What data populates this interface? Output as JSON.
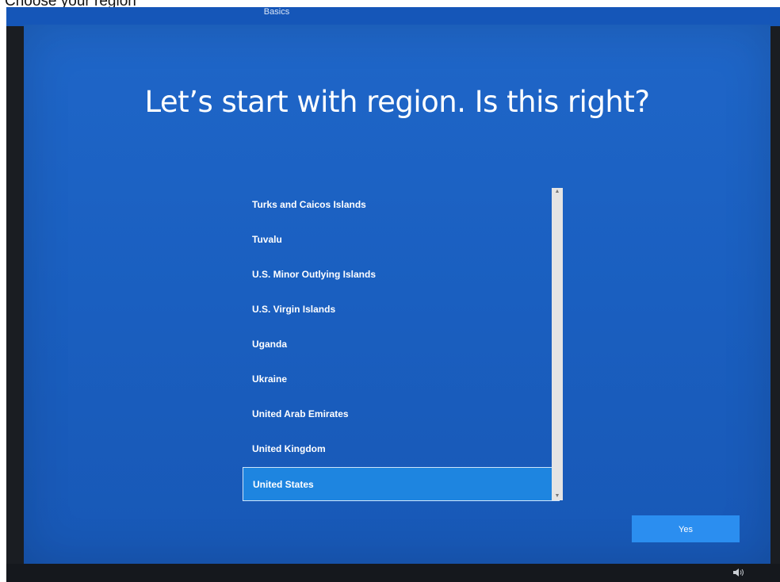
{
  "caption": "Choose your region",
  "header": {
    "tab_label": "Basics"
  },
  "main": {
    "title": "Let’s start with region. Is this right?",
    "regions": [
      {
        "label": "Turks and Caicos Islands",
        "selected": false
      },
      {
        "label": "Tuvalu",
        "selected": false
      },
      {
        "label": "U.S. Minor Outlying Islands",
        "selected": false
      },
      {
        "label": "U.S. Virgin Islands",
        "selected": false
      },
      {
        "label": "Uganda",
        "selected": false
      },
      {
        "label": "Ukraine",
        "selected": false
      },
      {
        "label": "United Arab Emirates",
        "selected": false
      },
      {
        "label": "United Kingdom",
        "selected": false
      },
      {
        "label": "United States",
        "selected": true
      }
    ],
    "yes_label": "Yes"
  },
  "taskbar": {
    "volume_icon": "volume-icon"
  },
  "colors": {
    "background": "#1a5fc0",
    "selected_item": "#1e85e0",
    "button": "#2b8ef0"
  }
}
